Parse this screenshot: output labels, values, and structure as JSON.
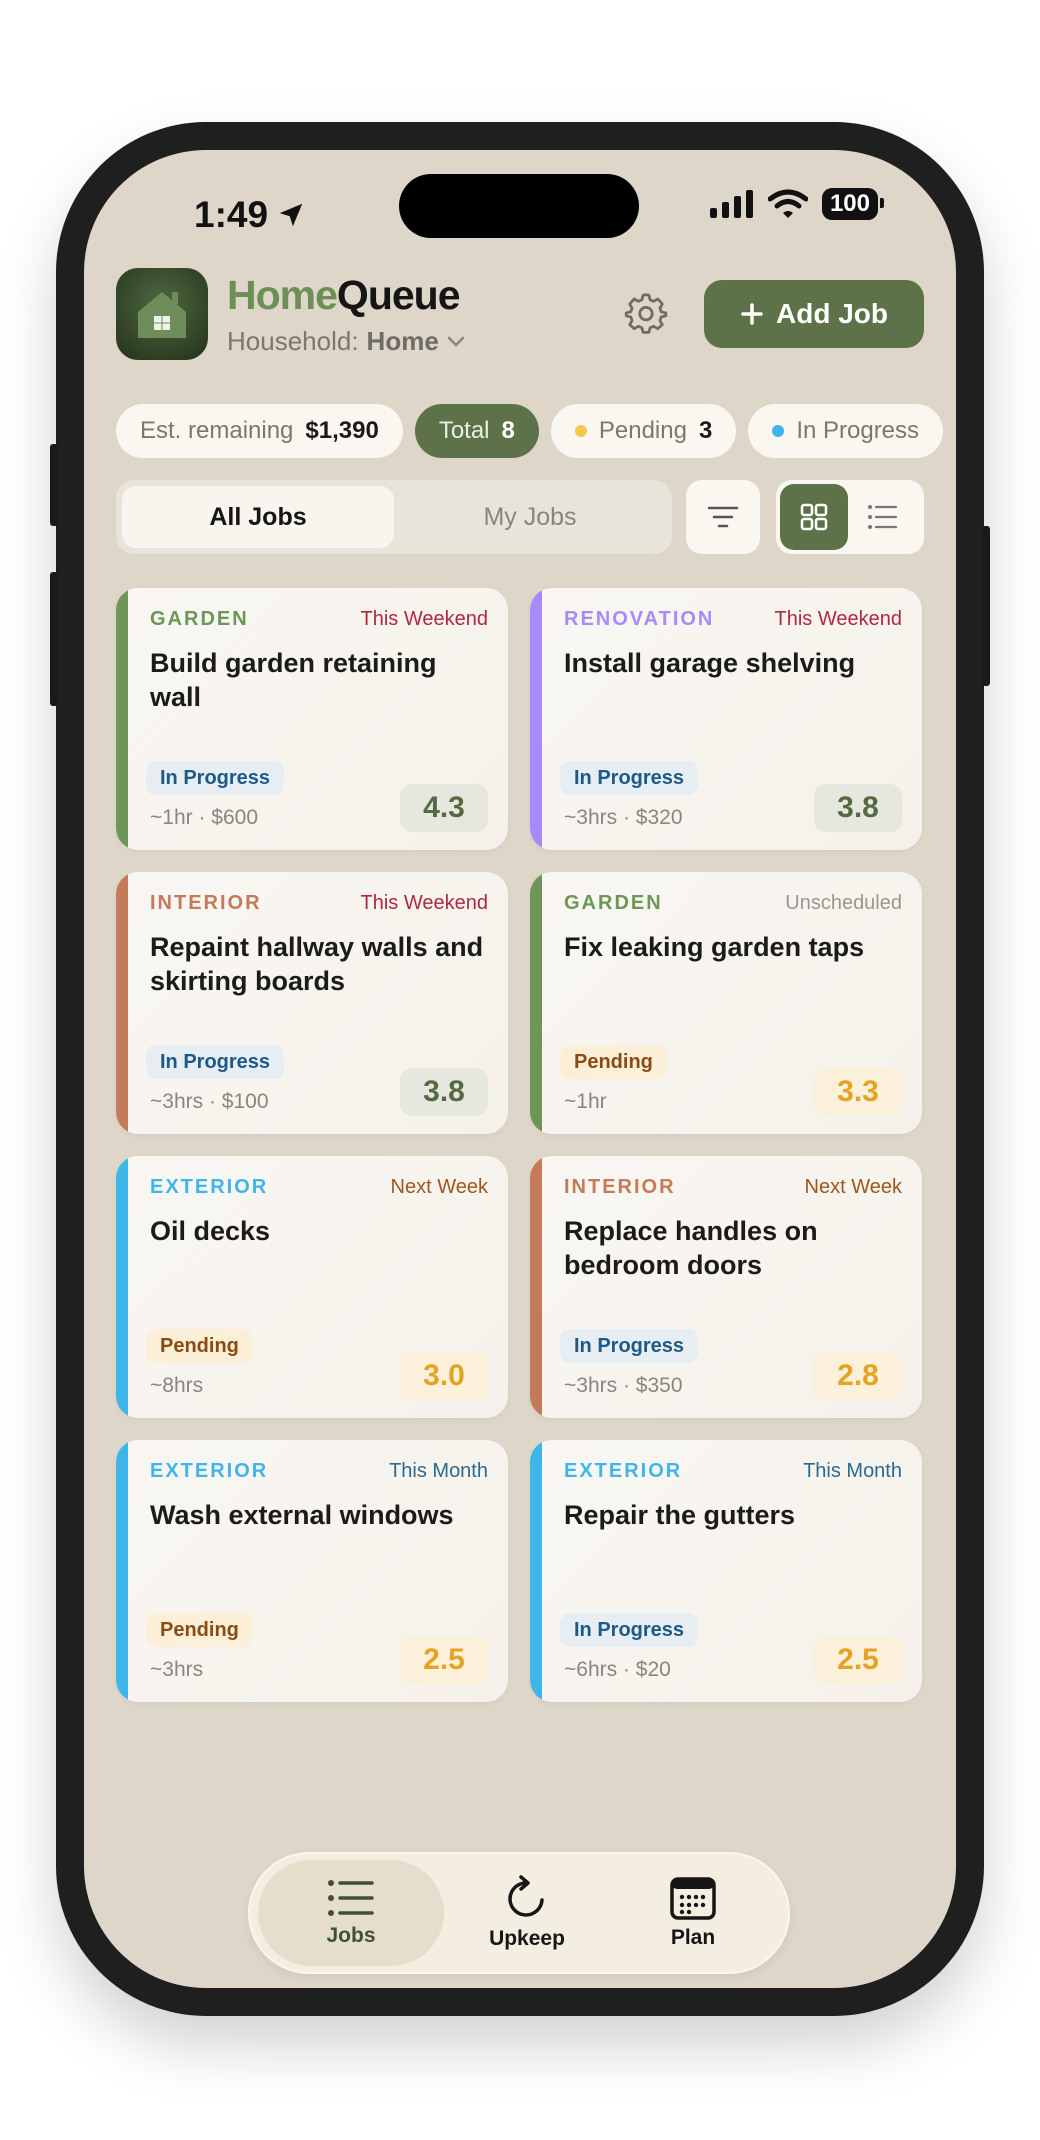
{
  "status_bar": {
    "time": "1:49",
    "battery": "100"
  },
  "header": {
    "title_part1": "Home",
    "title_part2": "Queue",
    "household_label": "Household:",
    "household_value": "Home",
    "add_job_label": "Add Job"
  },
  "chips": {
    "est_label": "Est. remaining",
    "est_value": "$1,390",
    "total_label": "Total",
    "total_value": "8",
    "pending_label": "Pending",
    "pending_value": "3",
    "inprogress_label": "In Progress",
    "pending_color": "#f2c94c",
    "inprogress_color": "#3fb6ea"
  },
  "segmented": {
    "all": "All Jobs",
    "mine": "My Jobs"
  },
  "jobs": [
    {
      "category": "GARDEN",
      "when": "This Weekend",
      "title": "Build garden retaining wall",
      "status": "In Progress",
      "meta": "~1hr · $600",
      "score": "4.3"
    },
    {
      "category": "RENOVATION",
      "when": "This Weekend",
      "title": "Install garage shelving",
      "status": "In Progress",
      "meta": "~3hrs · $320",
      "score": "3.8"
    },
    {
      "category": "INTERIOR",
      "when": "This Weekend",
      "title": "Repaint hallway walls and skirting boards",
      "status": "In Progress",
      "meta": "~3hrs · $100",
      "score": "3.8"
    },
    {
      "category": "GARDEN",
      "when": "Unscheduled",
      "title": "Fix leaking garden taps",
      "status": "Pending",
      "meta": "~1hr",
      "score": "3.3"
    },
    {
      "category": "EXTERIOR",
      "when": "Next Week",
      "title": "Oil decks",
      "status": "Pending",
      "meta": "~8hrs",
      "score": "3.0"
    },
    {
      "category": "INTERIOR",
      "when": "Next Week",
      "title": "Replace handles on bedroom doors",
      "status": "In Progress",
      "meta": "~3hrs · $350",
      "score": "2.8"
    },
    {
      "category": "EXTERIOR",
      "when": "This Month",
      "title": "Wash external windows",
      "status": "Pending",
      "meta": "~3hrs",
      "score": "2.5"
    },
    {
      "category": "EXTERIOR",
      "when": "This Month",
      "title": "Repair the gutters",
      "status": "In Progress",
      "meta": "~6hrs · $20",
      "score": "2.5"
    }
  ],
  "category_colors": {
    "garden": "#6d9657",
    "renovation": "#a78bfa",
    "interior": "#c57a5a",
    "exterior": "#3fb6ea"
  },
  "tabs": [
    {
      "label": "Jobs",
      "icon": "list-icon"
    },
    {
      "label": "Upkeep",
      "icon": "refresh-icon"
    },
    {
      "label": "Plan",
      "icon": "calendar-icon"
    }
  ]
}
